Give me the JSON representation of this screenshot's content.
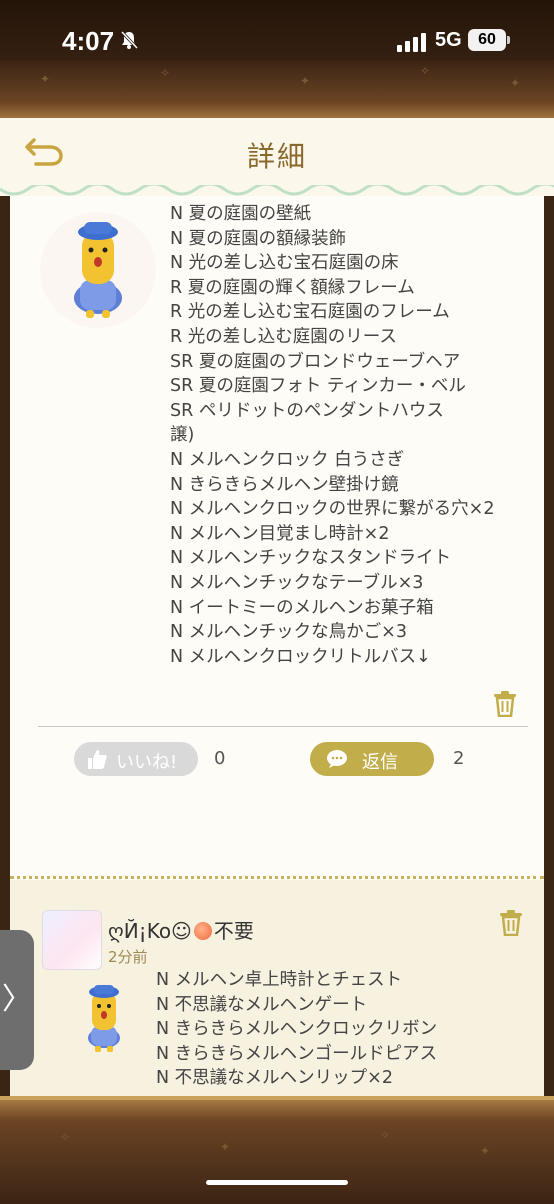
{
  "status": {
    "time": "4:07",
    "network": "5G",
    "battery": "60"
  },
  "header": {
    "title": "詳細"
  },
  "post": {
    "lines": [
      "N 夏の庭園の壁紙",
      "N 夏の庭園の額縁装飾",
      "N 光の差し込む宝石庭園の床",
      "R 夏の庭園の輝く額縁フレーム",
      "R 光の差し込む宝石庭園のフレーム",
      "R 光の差し込む庭園のリース",
      "SR 夏の庭園のブロンドウェーブヘア",
      "SR 夏の庭園フォト ティンカー・ベル",
      "SR ペリドットのペンダントハウス",
      "譲)",
      "N メルヘンクロック 白うさぎ",
      "N きらきらメルヘン壁掛け鏡",
      "N メルヘンクロックの世界に繋がる穴×2",
      "N メルヘン目覚まし時計×2",
      "N メルヘンチックなスタンドライト",
      "N メルヘンチックなテーブル×3",
      "N イートミーのメルヘンお菓子箱",
      "N メルヘンチックな鳥かご×3",
      "N メルヘンクロックリトルバス↓"
    ],
    "like_label": "いいね!",
    "like_count": "0",
    "reply_label": "返信",
    "reply_count": "2"
  },
  "comment": {
    "user_prefix": "ღЙ¡Ko☺",
    "user_suffix": "不要",
    "time": "2分前",
    "lines": [
      "N メルヘン卓上時計とチェスト",
      "N 不思議なメルヘンゲート",
      "N きらきらメルヘンクロックリボン",
      "N きらきらメルヘンゴールドピアス",
      "N 不思議なメルヘンリップ×2"
    ]
  },
  "side_tab": {
    "label": "〉"
  },
  "colors": {
    "accent": "#c2ad4b",
    "title": "#8a6a2c",
    "frame": "#6b4423"
  }
}
